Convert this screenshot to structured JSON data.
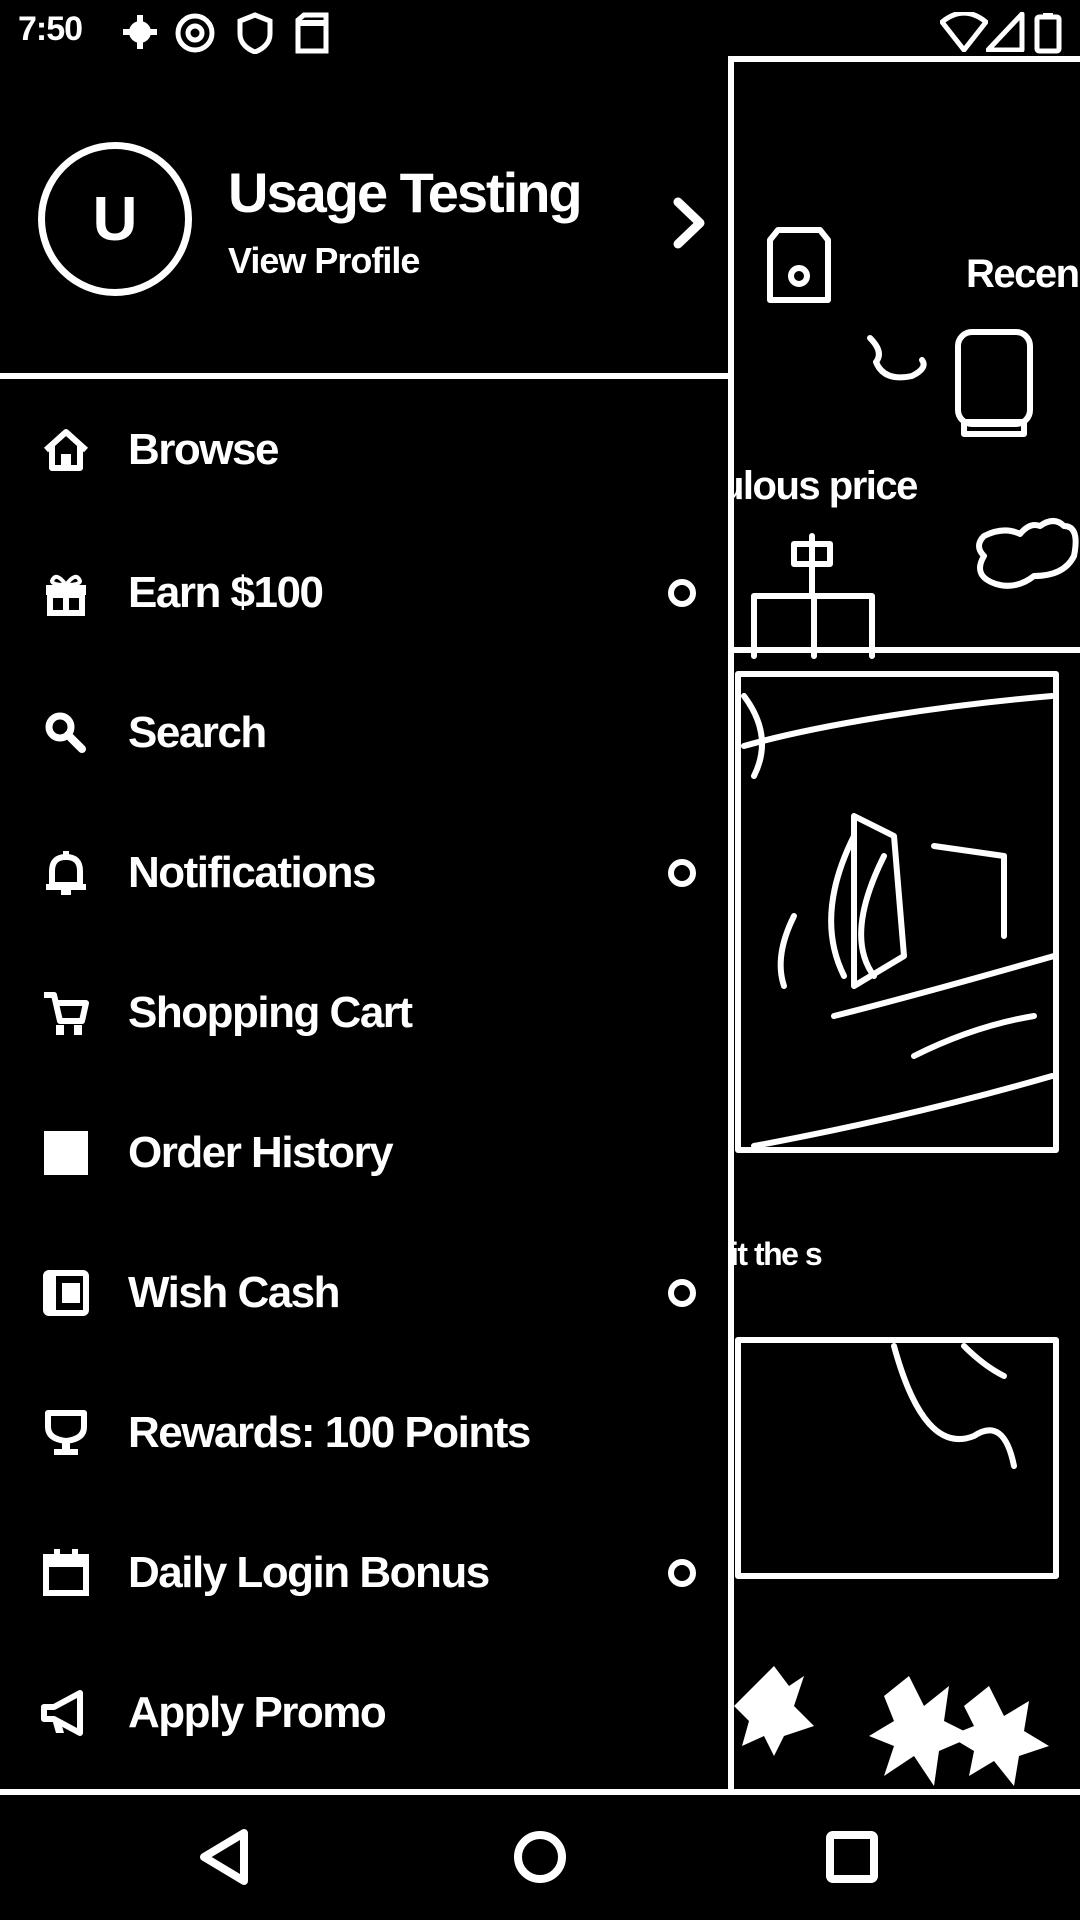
{
  "status_bar": {
    "time": "7:50",
    "icons": [
      "settings-notification-icon",
      "at-sign-icon",
      "shield-icon",
      "sd-card-icon",
      "wifi-icon",
      "signal-icon",
      "battery-icon"
    ]
  },
  "drawer": {
    "profile": {
      "avatar_initial": "U",
      "name": "Usage Testing",
      "link": "View Profile"
    },
    "items": [
      {
        "label": "Browse",
        "icon": "home-icon",
        "badge": false
      },
      {
        "label": "Earn $100",
        "icon": "gift-icon",
        "badge": true
      },
      {
        "label": "Search",
        "icon": "search-icon",
        "badge": false
      },
      {
        "label": "Notifications",
        "icon": "bell-icon",
        "badge": true
      },
      {
        "label": "Shopping Cart",
        "icon": "cart-icon",
        "badge": false
      },
      {
        "label": "Order History",
        "icon": "order-history-icon",
        "badge": false
      },
      {
        "label": "Wish Cash",
        "icon": "wallet-icon",
        "badge": true
      },
      {
        "label": "Rewards: 100 Points",
        "icon": "trophy-icon",
        "badge": false
      },
      {
        "label": "Daily Login Bonus",
        "icon": "calendar-icon",
        "badge": true
      },
      {
        "label": "Apply Promo",
        "icon": "megaphone-icon",
        "badge": false
      }
    ]
  },
  "background": {
    "recent_label": "Recen",
    "price_text": "ulous price",
    "caption_text": "it the s"
  },
  "nav_bar": {
    "buttons": [
      "back-icon",
      "home-circle-icon",
      "recents-icon"
    ]
  }
}
